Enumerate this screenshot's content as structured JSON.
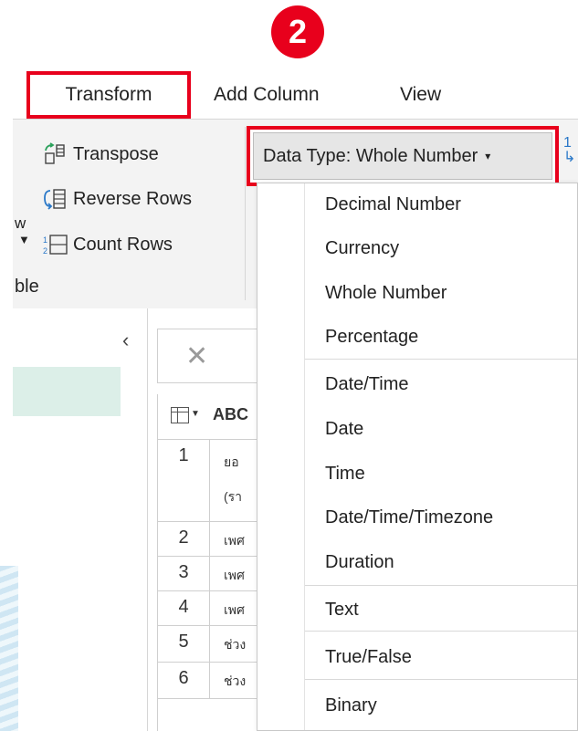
{
  "step_badge": "2",
  "tabs": {
    "transform": "Transform",
    "add_column": "Add Column",
    "view": "View"
  },
  "ribbon": {
    "transpose": "Transpose",
    "reverse_rows": "Reverse Rows",
    "count_rows": "Count Rows",
    "truncated_left": "w",
    "group_label": "ble",
    "truncated_right_top": "1",
    "truncated_right_bottom": "↳"
  },
  "data_type_button": {
    "label": "Data Type: Whole Number",
    "caret": "▾"
  },
  "left_panel": {
    "collapse": "‹"
  },
  "formula_bar": {
    "cancel": "✕"
  },
  "grid": {
    "column_type": "ABC",
    "rows": [
      {
        "num": "1",
        "lines": [
          "ยอ",
          "(รา"
        ]
      },
      {
        "num": "2",
        "lines": [
          "เพศ"
        ]
      },
      {
        "num": "3",
        "lines": [
          "เพศ"
        ]
      },
      {
        "num": "4",
        "lines": [
          "เพศ"
        ]
      },
      {
        "num": "5",
        "lines": [
          "ช่วง"
        ]
      },
      {
        "num": "6",
        "lines": [
          "ช่วง"
        ]
      }
    ]
  },
  "menu": {
    "items": [
      "Decimal Number",
      "Currency",
      "Whole Number",
      "Percentage",
      "Date/Time",
      "Date",
      "Time",
      "Date/Time/Timezone",
      "Duration",
      "Text",
      "True/False",
      "Binary"
    ]
  },
  "colors": {
    "highlight_red": "#e8001c",
    "ribbon_bg": "#f3f3f3",
    "selected_row_bg": "#dcefe8"
  }
}
